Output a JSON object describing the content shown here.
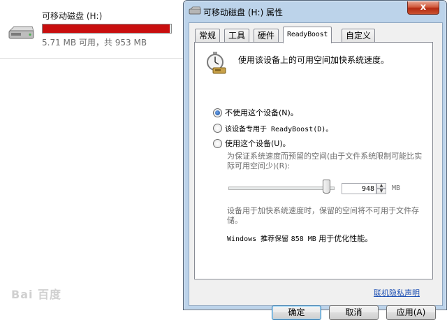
{
  "explorer": {
    "drive_name": "可移动磁盘 (H:)",
    "space_text": "5.71 MB 可用，共 953 MB",
    "used_fraction": 0.994,
    "bar_color": "#c90e0e"
  },
  "watermark": "Bai 百度",
  "dialog": {
    "title": "可移动磁盘 (H:) 属性",
    "close_label": "x",
    "tabs": [
      {
        "label": "常规"
      },
      {
        "label": "工具"
      },
      {
        "label": "硬件"
      },
      {
        "label": "ReadyBoost"
      },
      {
        "label": "自定义"
      }
    ],
    "active_tab": 3,
    "readyboost": {
      "description": "使用该设备上的可用空间加快系统速度。",
      "options": [
        {
          "label": "不使用这个设备(N)。",
          "selected": true
        },
        {
          "label": "该设备专用于 ReadyBoost(D)。",
          "selected": false
        },
        {
          "label": "使用这个设备(U)。",
          "selected": false
        }
      ],
      "reserve_label": "为保证系统速度而预留的空间(由于文件系统限制可能比实际可用空间少)(R):",
      "slider_fraction": 0.97,
      "reserve_value": "948",
      "unit": "MB",
      "note": "设备用于加快系统速度时，保留的空间将不可用于文件存储。",
      "recommend_prefix": "Windows 推荐保留",
      "recommend_value": "858 MB",
      "recommend_suffix": "用于优化性能。",
      "privacy_link": "联机隐私声明"
    },
    "buttons": {
      "ok": "确定",
      "cancel": "取消",
      "apply": "应用(A)"
    }
  }
}
